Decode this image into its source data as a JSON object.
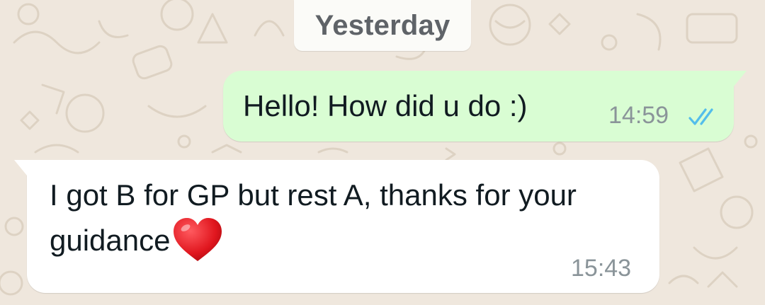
{
  "date_separator": "Yesterday",
  "messages": [
    {
      "direction": "outgoing",
      "text": "Hello! How did u do :)",
      "time": "14:59",
      "status_icon": "double-check-read-icon",
      "bubble_color": "#d9fdd3"
    },
    {
      "direction": "incoming",
      "text": "I got B for GP but rest A, thanks for your guidance",
      "emoji": "red-heart",
      "time": "15:43",
      "bubble_color": "#ffffff"
    }
  ],
  "colors": {
    "chat_background": "#efe7dd",
    "read_tick": "#53bdeb",
    "timestamp": "#8a9499",
    "text": "#111b21"
  }
}
